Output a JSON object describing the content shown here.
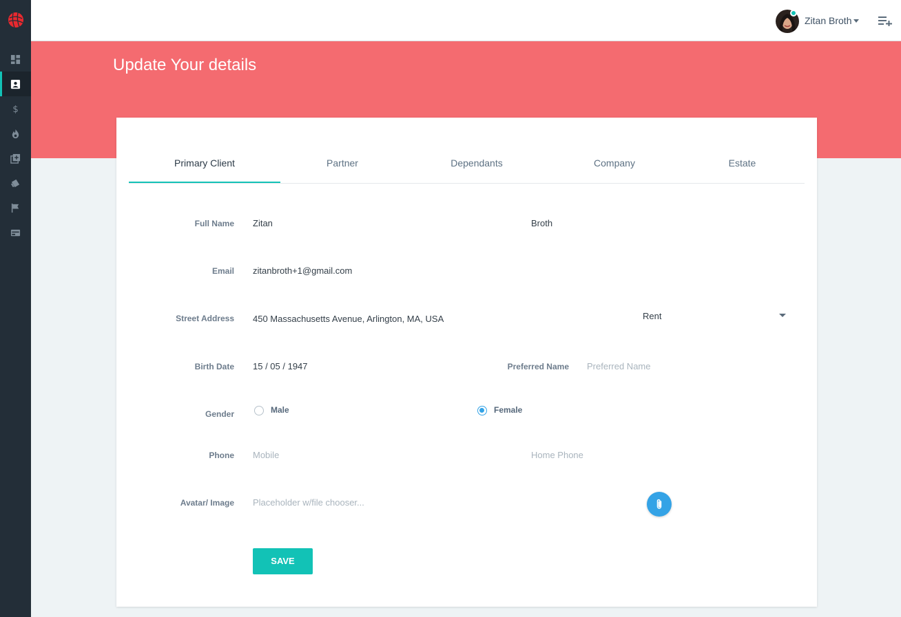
{
  "sidebar": {
    "items": [
      {
        "icon": "dashboard-icon",
        "active": false
      },
      {
        "icon": "contact-card-icon",
        "active": true
      },
      {
        "icon": "dollar-icon",
        "active": false
      },
      {
        "icon": "fire-icon",
        "active": false
      },
      {
        "icon": "library-add-icon",
        "active": false
      },
      {
        "icon": "tags-icon",
        "active": false
      },
      {
        "icon": "flag-icon",
        "active": false
      },
      {
        "icon": "credit-card-icon",
        "active": false
      }
    ]
  },
  "topbar": {
    "user_name": "Zitan Broth",
    "online_color": "#12c2b6"
  },
  "header": {
    "title": "Update Your details",
    "color": "#f46b70"
  },
  "tabs": [
    {
      "label": "Primary Client",
      "active": true
    },
    {
      "label": "Partner",
      "active": false
    },
    {
      "label": "Dependants",
      "active": false
    },
    {
      "label": "Company",
      "active": false
    },
    {
      "label": "Estate",
      "active": false
    }
  ],
  "form": {
    "full_name": {
      "label": "Full Name",
      "first": "Zitan",
      "last": "Broth"
    },
    "email": {
      "label": "Email",
      "value": "zitanbroth+1@gmail.com"
    },
    "street_address": {
      "label": "Street Address",
      "value": "450 Massachusetts Avenue, Arlington, MA, USA",
      "tenure": "Rent"
    },
    "birth_date": {
      "label": "Birth Date",
      "value": "15 / 05 / 1947"
    },
    "preferred_name": {
      "label": "Preferred Name",
      "placeholder": "Preferred Name"
    },
    "gender": {
      "label": "Gender",
      "options": [
        "Male",
        "Female"
      ],
      "selected": "Female"
    },
    "phone": {
      "label": "Phone",
      "mobile_placeholder": "Mobile",
      "home_placeholder": "Home Phone"
    },
    "avatar": {
      "label": "Avatar/ Image",
      "placeholder": "Placeholder w/file chooser..."
    },
    "save_label": "SAVE"
  },
  "colors": {
    "accent": "#12c2b6",
    "primary_blue": "#34a3e6",
    "sidebar": "#232e38"
  }
}
